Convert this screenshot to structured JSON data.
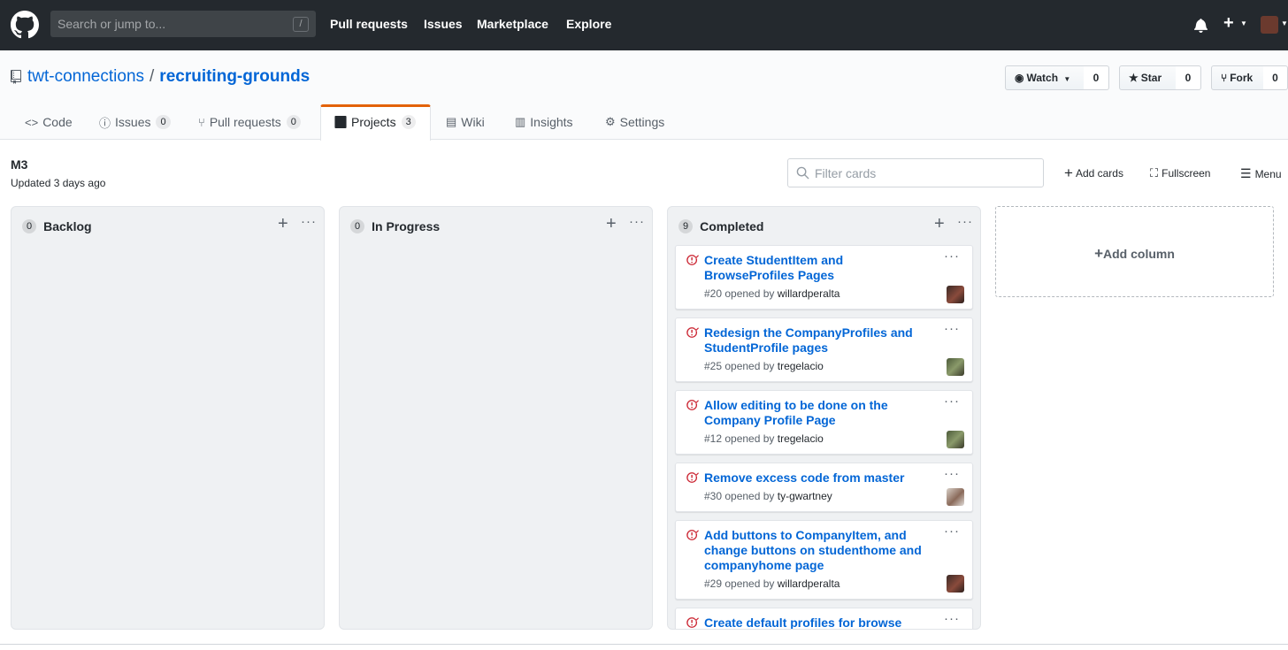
{
  "header": {
    "search_placeholder": "Search or jump to...",
    "search_key": "/",
    "nav": [
      "Pull requests",
      "Issues",
      "Marketplace",
      "Explore"
    ]
  },
  "repo": {
    "owner": "twt-connections",
    "separator": "/",
    "name": "recruiting-grounds",
    "watch_label": "Watch",
    "watch_count": "0",
    "star_label": "Star",
    "star_count": "0",
    "fork_label": "Fork",
    "fork_count": "0"
  },
  "tabs": [
    {
      "label": "Code",
      "count": null,
      "icon": "code-icon"
    },
    {
      "label": "Issues",
      "count": "0",
      "icon": "issue-icon"
    },
    {
      "label": "Pull requests",
      "count": "0",
      "icon": "pull-request-icon"
    },
    {
      "label": "Projects",
      "count": "3",
      "icon": "project-icon",
      "selected": true
    },
    {
      "label": "Wiki",
      "count": null,
      "icon": "book-icon"
    },
    {
      "label": "Insights",
      "count": null,
      "icon": "graph-icon"
    },
    {
      "label": "Settings",
      "count": null,
      "icon": "gear-icon"
    }
  ],
  "project": {
    "name": "M3",
    "updated": "Updated 3 days ago",
    "filter_placeholder": "Filter cards",
    "add_cards": "Add cards",
    "fullscreen": "Fullscreen",
    "menu": "Menu"
  },
  "columns": [
    {
      "title": "Backlog",
      "count": "0",
      "cards": []
    },
    {
      "title": "In Progress",
      "count": "0",
      "cards": []
    },
    {
      "title": "Completed",
      "count": "9",
      "cards": [
        {
          "title": "Create StudentItem and BrowseProfiles Pages",
          "number": "#20 opened by",
          "author": "willardperalta"
        },
        {
          "title": "Redesign the CompanyProfiles and StudentProfile pages",
          "number": "#25 opened by",
          "author": "tregelacio"
        },
        {
          "title": "Allow editing to be done on the Company Profile Page",
          "number": "#12 opened by",
          "author": "tregelacio"
        },
        {
          "title": "Remove excess code from master",
          "number": "#30 opened by",
          "author": "ty-gwartney"
        },
        {
          "title": "Add buttons to CompanyItem, and change buttons on studenthome and companyhome page",
          "number": "#29 opened by",
          "author": "willardperalta"
        },
        {
          "title": "Create default profiles for browse",
          "number": "",
          "author": ""
        }
      ]
    }
  ],
  "add_column": "Add column",
  "colors": {
    "link": "#0366d6",
    "header_bg": "#24292e",
    "closed_issue": "#cb2431",
    "tab_accent": "#e36209"
  }
}
